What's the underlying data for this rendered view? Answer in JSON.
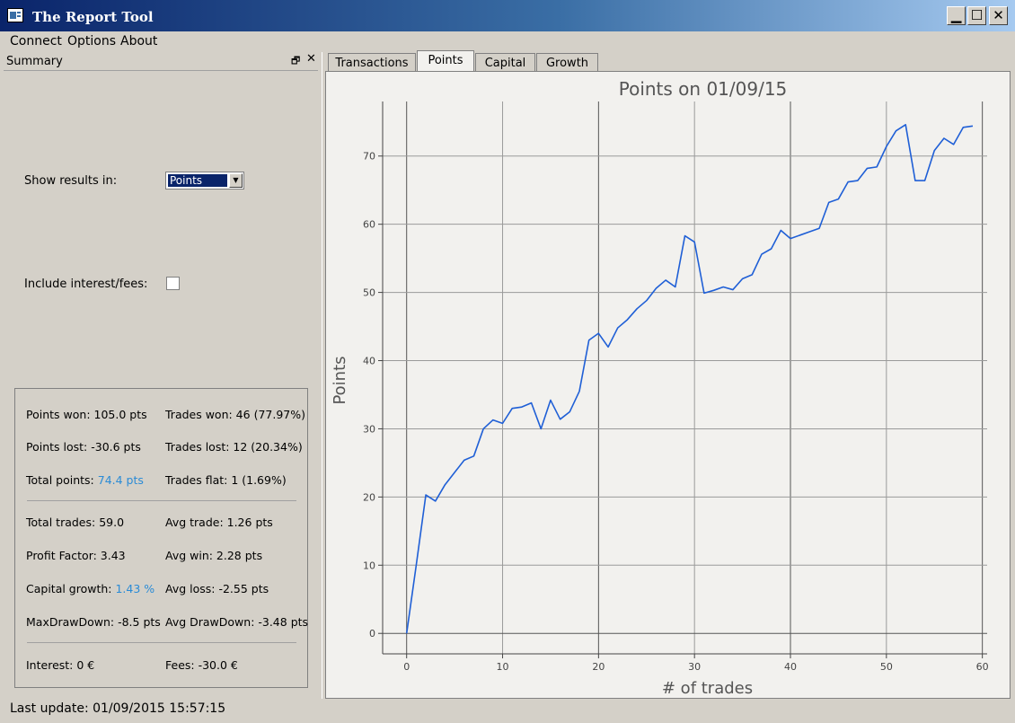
{
  "window": {
    "title": "The Report Tool",
    "icon": "report-icon",
    "minimize": "▁",
    "maximize": "☐",
    "close": "✕"
  },
  "menu": [
    "Connect",
    "Options",
    "About"
  ],
  "dock": {
    "title": "Summary",
    "float_icon": "🗗",
    "close_icon": "✕"
  },
  "settings": {
    "show_results_label": "Show results in:",
    "show_results_value": "Points",
    "combo_arrow": "▼",
    "interest_label": "Include interest/fees:",
    "interest_checked": false
  },
  "stats": {
    "points_won": "Points won: 105.0 pts",
    "trades_won": "Trades won: 46 (77.97%)",
    "points_lost": "Points lost: -30.6 pts",
    "trades_lost": "Trades lost: 12 (20.34%)",
    "total_points_label": "Total points: ",
    "total_points_value": "74.4 pts",
    "trades_flat": "Trades flat: 1 (1.69%)",
    "total_trades": "Total trades: 59.0",
    "avg_trade": "Avg trade: 1.26 pts",
    "profit_factor": "Profit Factor: 3.43",
    "avg_win": "Avg win: 2.28 pts",
    "capital_growth_label": "Capital growth: ",
    "capital_growth_value": "1.43 %",
    "avg_loss": "Avg loss: -2.55 pts",
    "max_drawdown": "MaxDrawDown: -8.5 pts",
    "avg_drawdown": "Avg DrawDown: -3.48 pts",
    "interest": "Interest: 0 €",
    "fees": "Fees: -30.0 €"
  },
  "status": "Last update: 01/09/2015 15:57:15",
  "tabs": [
    {
      "label": "Transactions",
      "active": false
    },
    {
      "label": "Points",
      "active": true
    },
    {
      "label": "Capital",
      "active": false
    },
    {
      "label": "Growth",
      "active": false
    }
  ],
  "colors": {
    "line": "#1f5fd6",
    "highlight": "#2a8bd6",
    "title_gradient_start": "#0a246a"
  },
  "chart_data": {
    "type": "line",
    "title": "Points on 01/09/15",
    "xlabel": "# of trades",
    "ylabel": "Points",
    "xlim": [
      -2.5,
      60.5
    ],
    "ylim": [
      -3,
      78
    ],
    "xticks": [
      0,
      10,
      20,
      30,
      40,
      50,
      60
    ],
    "yticks": [
      0,
      10,
      20,
      30,
      40,
      50,
      60,
      70
    ],
    "grid": true,
    "x": [
      0,
      1,
      2,
      3,
      4,
      5,
      6,
      7,
      8,
      9,
      10,
      11,
      12,
      13,
      14,
      15,
      16,
      17,
      18,
      19,
      20,
      21,
      22,
      23,
      24,
      25,
      26,
      27,
      28,
      29,
      30,
      31,
      32,
      33,
      34,
      35,
      36,
      37,
      38,
      39,
      40,
      41,
      42,
      43,
      44,
      45,
      46,
      47,
      48,
      49,
      50,
      51,
      52,
      53,
      54,
      55,
      56,
      57,
      58,
      59
    ],
    "series": [
      {
        "values": [
          0,
          10,
          20.3,
          19.4,
          21.8,
          23.6,
          25.4,
          26.0,
          30.0,
          31.3,
          30.8,
          33.0,
          33.2,
          33.8,
          30.0,
          34.2,
          31.4,
          32.5,
          35.5,
          43.0,
          44.0,
          42.0,
          44.8,
          46.0,
          47.6,
          48.8,
          50.6,
          51.8,
          50.8,
          58.3,
          57.4,
          49.9,
          50.3,
          50.8,
          50.4,
          52.0,
          52.6,
          55.6,
          56.4,
          59.1,
          57.9,
          58.4,
          58.9,
          59.4,
          63.2,
          63.7,
          66.2,
          66.4,
          68.2,
          68.4,
          71.4,
          73.7,
          74.6,
          66.4,
          66.4,
          70.8,
          72.6,
          71.7,
          74.2,
          74.4
        ]
      }
    ]
  }
}
